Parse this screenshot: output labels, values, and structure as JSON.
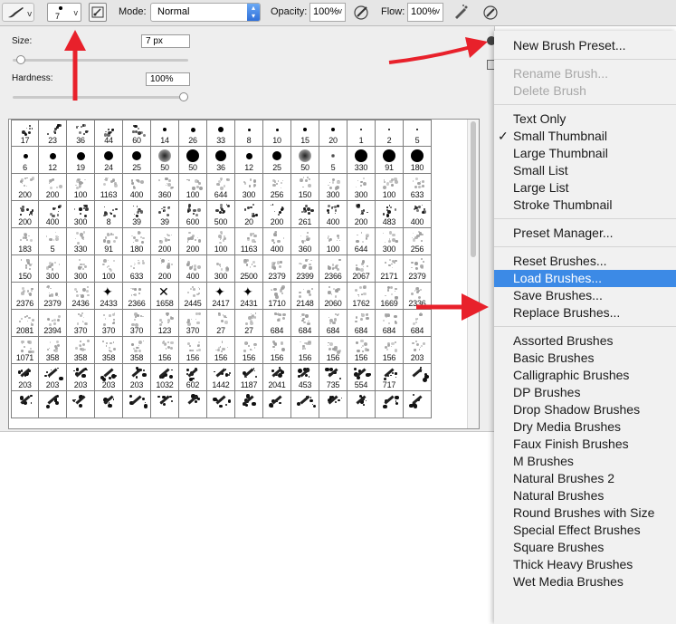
{
  "toolbar": {
    "brush_size": "7",
    "mode_label": "Mode:",
    "mode_value": "Normal",
    "opacity_label": "Opacity:",
    "opacity_value": "100%",
    "flow_label": "Flow:",
    "flow_value": "100%"
  },
  "brush_panel": {
    "size_label": "Size:",
    "size_value": "7 px",
    "size_slider_fraction": 0.02,
    "hardness_label": "Hardness:",
    "hardness_value": "100%",
    "hardness_slider_fraction": 1.0
  },
  "brush_tips": [
    [
      "17",
      "23",
      "36",
      "44",
      "60",
      "14",
      "26",
      "33",
      "8",
      "10",
      "15",
      "20",
      "1",
      "2",
      "5"
    ],
    [
      "6",
      "12",
      "19",
      "24",
      "25",
      "50",
      "50",
      "36",
      "12",
      "25",
      "50",
      "5",
      "330",
      "91",
      "180"
    ],
    [
      "200",
      "200",
      "100",
      "1163",
      "400",
      "360",
      "100",
      "644",
      "300",
      "256",
      "150",
      "300",
      "300",
      "100",
      "633"
    ],
    [
      "200",
      "400",
      "300",
      "8",
      "39",
      "39",
      "600",
      "500",
      "20",
      "200",
      "261",
      "400",
      "200",
      "483",
      "400"
    ],
    [
      "183",
      "5",
      "330",
      "91",
      "180",
      "200",
      "200",
      "100",
      "1163",
      "400",
      "360",
      "100",
      "644",
      "300",
      "256"
    ],
    [
      "150",
      "300",
      "300",
      "100",
      "633",
      "200",
      "400",
      "300",
      "2500",
      "2379",
      "2399",
      "2366",
      "2067",
      "2171",
      "2379"
    ],
    [
      "2376",
      "2379",
      "2436",
      "2433",
      "2366",
      "1658",
      "2445",
      "2417",
      "2431",
      "1710",
      "2148",
      "2060",
      "1762",
      "1669",
      "2336"
    ],
    [
      "2081",
      "2394",
      "370",
      "370",
      "370",
      "123",
      "370",
      "27",
      "27",
      "684",
      "684",
      "684",
      "684",
      "684",
      "684"
    ],
    [
      "1071",
      "358",
      "358",
      "358",
      "358",
      "156",
      "156",
      "156",
      "156",
      "156",
      "156",
      "156",
      "156",
      "156",
      "203"
    ],
    [
      "203",
      "203",
      "203",
      "203",
      "203",
      "1032",
      "602",
      "1442",
      "1187",
      "2041",
      "453",
      "735",
      "554",
      "717",
      ""
    ],
    [
      "",
      "",
      "",
      "",
      "",
      "",
      "",
      "",
      "",
      "",
      "",
      "",
      "",
      "",
      ""
    ]
  ],
  "menu": {
    "groups": [
      [
        {
          "label": "New Brush Preset...",
          "state": "normal"
        }
      ],
      [
        {
          "label": "Rename Brush...",
          "state": "disabled"
        },
        {
          "label": "Delete Brush",
          "state": "disabled"
        }
      ],
      [
        {
          "label": "Text Only",
          "state": "normal"
        },
        {
          "label": "Small Thumbnail",
          "state": "checked"
        },
        {
          "label": "Large Thumbnail",
          "state": "normal"
        },
        {
          "label": "Small List",
          "state": "normal"
        },
        {
          "label": "Large List",
          "state": "normal"
        },
        {
          "label": "Stroke Thumbnail",
          "state": "normal"
        }
      ],
      [
        {
          "label": "Preset Manager...",
          "state": "normal"
        }
      ],
      [
        {
          "label": "Reset Brushes...",
          "state": "normal"
        },
        {
          "label": "Load Brushes...",
          "state": "highlighted"
        },
        {
          "label": "Save Brushes...",
          "state": "normal"
        },
        {
          "label": "Replace Brushes...",
          "state": "normal"
        }
      ],
      [
        {
          "label": "Assorted Brushes",
          "state": "normal"
        },
        {
          "label": "Basic Brushes",
          "state": "normal"
        },
        {
          "label": "Calligraphic Brushes",
          "state": "normal"
        },
        {
          "label": "DP Brushes",
          "state": "normal"
        },
        {
          "label": "Drop Shadow Brushes",
          "state": "normal"
        },
        {
          "label": "Dry Media Brushes",
          "state": "normal"
        },
        {
          "label": "Faux Finish Brushes",
          "state": "normal"
        },
        {
          "label": "M Brushes",
          "state": "normal"
        },
        {
          "label": "Natural Brushes 2",
          "state": "normal"
        },
        {
          "label": "Natural Brushes",
          "state": "normal"
        },
        {
          "label": "Round Brushes with Size",
          "state": "normal"
        },
        {
          "label": "Special Effect Brushes",
          "state": "normal"
        },
        {
          "label": "Square Brushes",
          "state": "normal"
        },
        {
          "label": "Thick Heavy Brushes",
          "state": "normal"
        },
        {
          "label": "Wet Media Brushes",
          "state": "normal"
        }
      ]
    ],
    "check_glyph": "✓"
  },
  "colors": {
    "menu_highlight": "#3c8ae6",
    "annotation_arrow": "#e8212b",
    "mode_select_accent": "#2f6fd9"
  },
  "icons": [
    "brush-tool-icon",
    "chevron-down-icon",
    "brush-panel-toggle-icon",
    "pressure-opacity-icon",
    "airbrush-icon",
    "pressure-size-icon",
    "gear-icon",
    "checkmark-icon"
  ]
}
